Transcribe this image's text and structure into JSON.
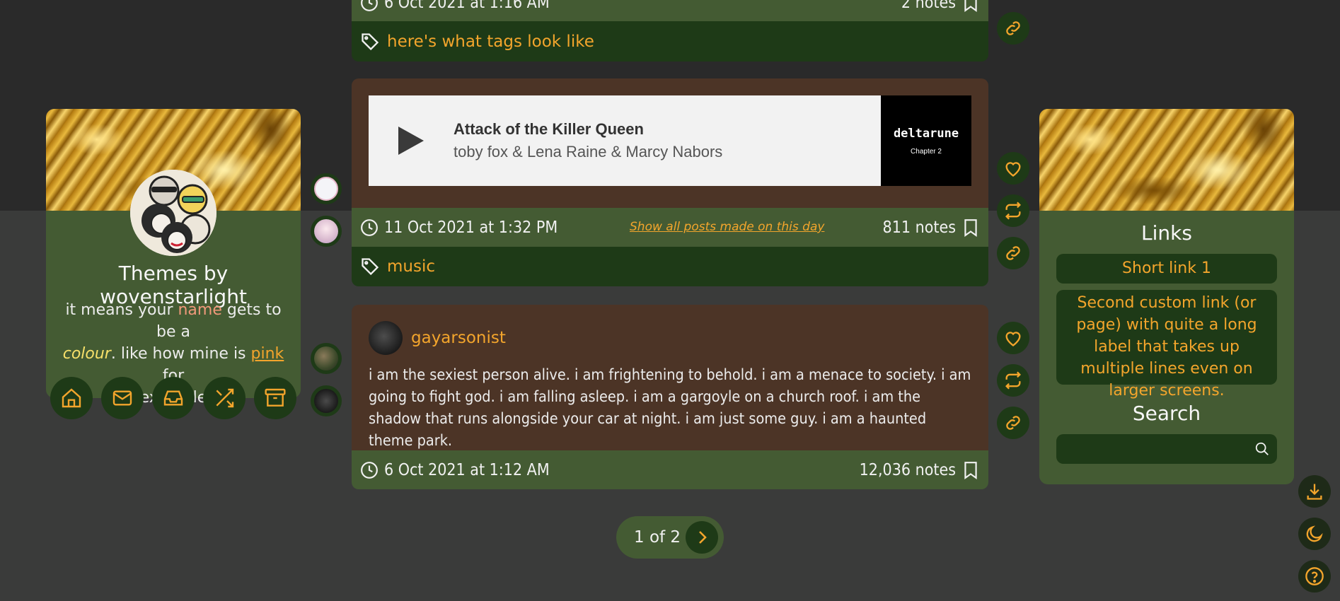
{
  "posts": [
    {
      "date": "6 Oct 2021 at 1:16 AM",
      "notes": "2 notes",
      "tag": "here's what tags look like"
    },
    {
      "audio": {
        "title": "Attack of the Killer Queen",
        "artist": "toby fox & Lena Raine & Marcy Nabors",
        "album_logo": "deltarune",
        "album_sub": "Chapter 2"
      },
      "date": "11 Oct 2021 at 1:32 PM",
      "day_link": "Show all posts made on this day",
      "notes": "811 notes",
      "tag": "music"
    },
    {
      "author": "gayarsonist",
      "text": "i am the sexiest person alive. i am frightening to behold. i am a menace to society. i am going to fight god. i am falling asleep. i am a gargoyle on a church roof. i am the shadow that runs alongside your car at night. i am just some guy. i am a haunted theme park.",
      "date": "6 Oct 2021 at 1:12 AM",
      "notes": "12,036 notes"
    }
  ],
  "profile": {
    "title": "Themes by wovenstarlight",
    "desc_1": "it means your ",
    "desc_name": "name",
    "desc_2": " gets to be a",
    "desc_colour": "colour",
    "desc_3": ". like how mine is ",
    "desc_pink": "pink",
    "desc_4": " for",
    "desc_5": "example"
  },
  "nav_icons": [
    "home-icon",
    "mail-icon",
    "inbox-icon",
    "shuffle-icon",
    "archive-icon"
  ],
  "sidebar": {
    "links_heading": "Links",
    "link_1": "Short link 1",
    "link_2": "Second custom link (or page) with quite a long label that takes up multiple lines even on larger screens.",
    "search_heading": "Search",
    "search_placeholder": ""
  },
  "pagination": {
    "label": "1 of 2"
  },
  "colors": {
    "accent": "#f3a52c",
    "name": "#f0997a",
    "colour": "#f7e06a",
    "card_green": "#445b33",
    "dark_green": "#1e3a17",
    "post_brown": "#4c3426"
  }
}
